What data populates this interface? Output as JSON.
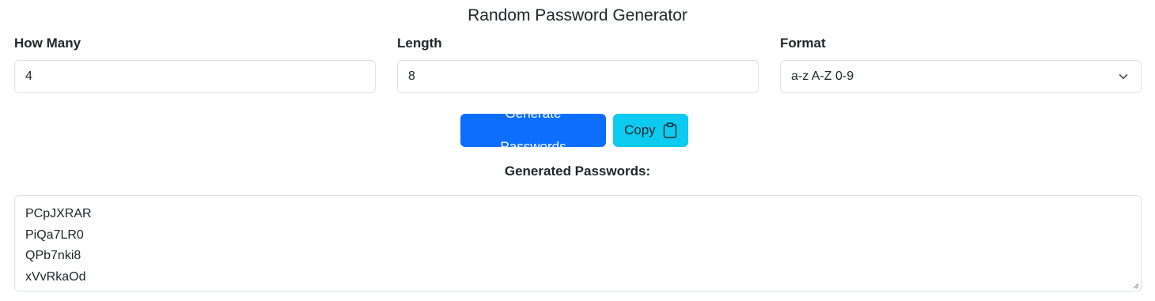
{
  "title": "Random Password Generator",
  "fields": {
    "how_many": {
      "label": "How Many",
      "value": "4"
    },
    "length": {
      "label": "Length",
      "value": "8"
    },
    "format": {
      "label": "Format",
      "selected": "a-z A-Z 0-9"
    }
  },
  "buttons": {
    "generate": "Generate Passwords",
    "copy": "Copy",
    "copy_icon": "clipboard-icon"
  },
  "output": {
    "label": "Generated Passwords:",
    "passwords": [
      "PCpJXRAR",
      "PiQa7LR0",
      "QPb7nki8",
      "xVvRkaOd"
    ]
  },
  "colors": {
    "primary": "#0d6efd",
    "info": "#0dcaf0",
    "border": "#dee2e6",
    "text": "#212529"
  }
}
